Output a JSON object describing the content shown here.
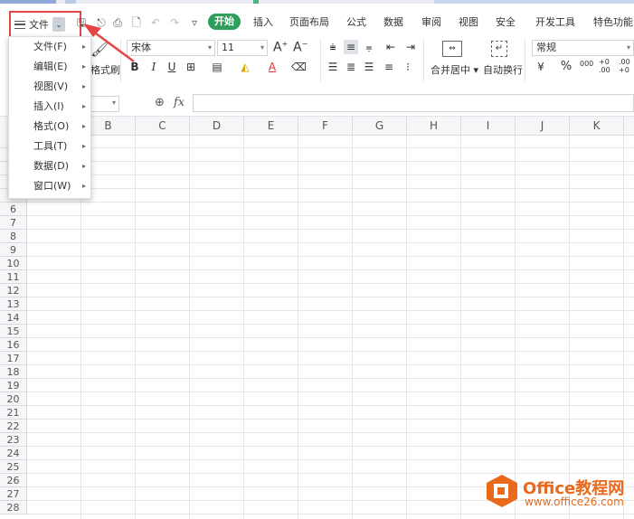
{
  "menubar": {
    "file_label": "文件",
    "start_tab": "开始",
    "tabs": [
      "插入",
      "页面布局",
      "公式",
      "数据",
      "审阅",
      "视图",
      "安全",
      "开发工具",
      "特色功能"
    ]
  },
  "ribbon": {
    "format_painter": "格式刷",
    "font_name": "宋体",
    "font_size": "11",
    "merge_center": "合并居中",
    "auto_wrap": "自动换行",
    "number_format": "常规",
    "percent": "%",
    "thousands": "000",
    "inc_decimal": "+0 .00",
    "dec_decimal": ".00 +0"
  },
  "formula_bar": {
    "fx_label": "fx"
  },
  "file_dropdown": {
    "items": [
      {
        "label": "文件(F)"
      },
      {
        "label": "编辑(E)"
      },
      {
        "label": "视图(V)"
      },
      {
        "label": "插入(I)"
      },
      {
        "label": "格式(O)"
      },
      {
        "label": "工具(T)"
      },
      {
        "label": "数据(D)"
      },
      {
        "label": "窗口(W)"
      }
    ]
  },
  "sheet": {
    "columns": [
      "B",
      "C",
      "D",
      "E",
      "F",
      "G",
      "H",
      "I",
      "J",
      "K"
    ],
    "visible_rows": [
      "6",
      "7",
      "8",
      "9",
      "10",
      "11",
      "12",
      "13",
      "14",
      "15",
      "16",
      "17",
      "18",
      "19",
      "20",
      "21",
      "22",
      "23",
      "24",
      "25",
      "26",
      "27",
      "28"
    ]
  },
  "watermark": {
    "title": "Office教程网",
    "url": "www.office26.com"
  },
  "colors": {
    "accent_green": "#2e9e5b",
    "highlight_red": "#e64545",
    "logo_orange": "#e86a1a"
  }
}
